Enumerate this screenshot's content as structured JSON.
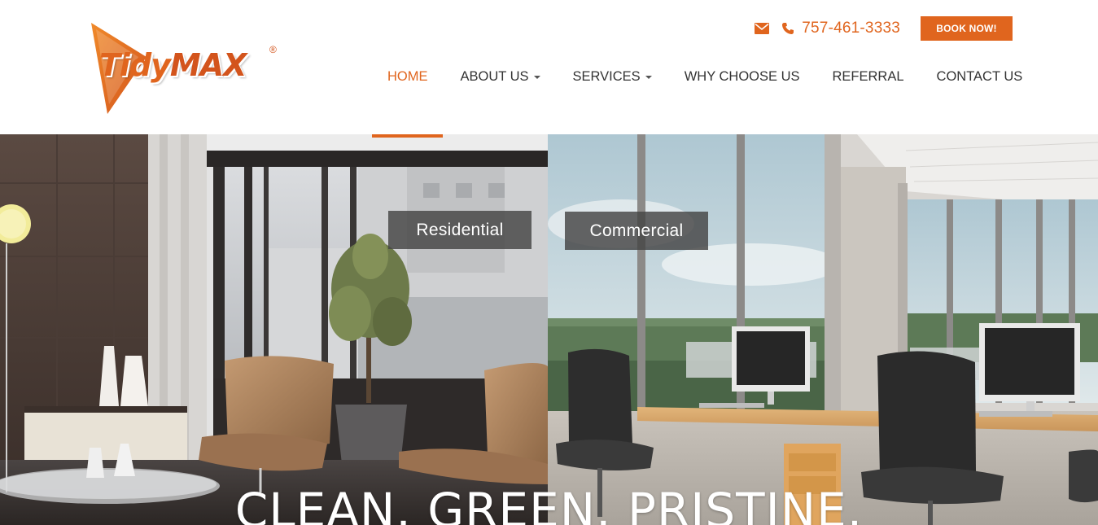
{
  "logo": {
    "text_tidy": "Tidy",
    "text_max": "MAX",
    "registered": "®"
  },
  "topbar": {
    "mail_icon": "envelope-icon",
    "phone_icon": "phone-icon",
    "phone": "757-461-3333",
    "book_label": "BOOK NOW!"
  },
  "nav": {
    "items": [
      {
        "label": "HOME",
        "active": true,
        "dropdown": false
      },
      {
        "label": "ABOUT US",
        "active": false,
        "dropdown": true
      },
      {
        "label": "SERVICES",
        "active": false,
        "dropdown": true
      },
      {
        "label": "WHY CHOOSE US",
        "active": false,
        "dropdown": false
      },
      {
        "label": "REFERRAL",
        "active": false,
        "dropdown": false
      },
      {
        "label": "CONTACT US",
        "active": false,
        "dropdown": false
      }
    ]
  },
  "hero": {
    "residential_label": "Residential",
    "commercial_label": "Commercial",
    "tagline": "CLEAN. GREEN. PRISTINE."
  },
  "colors": {
    "accent": "#e0651e",
    "nav_text": "#333333",
    "label_bg": "#444444"
  }
}
